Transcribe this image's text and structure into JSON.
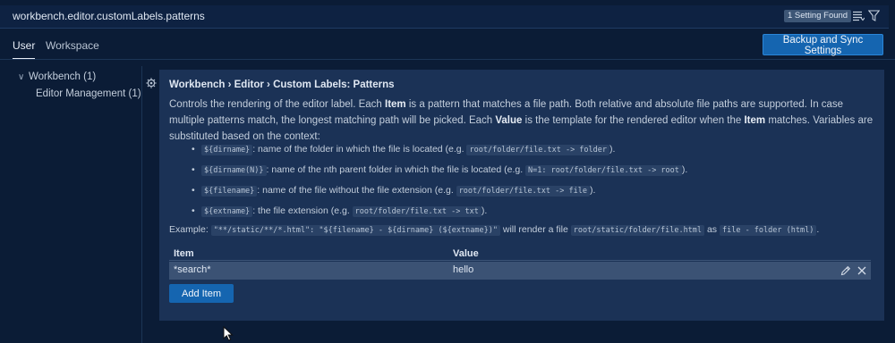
{
  "search": {
    "query": "workbench.editor.customLabels.patterns",
    "found_badge": "1 Setting Found"
  },
  "tabs": {
    "user": "User",
    "workspace": "Workspace"
  },
  "sync_button": "Backup and Sync Settings",
  "tree": {
    "workbench": "Workbench (1)",
    "editor_management": "Editor Management (1)"
  },
  "setting": {
    "title": "Workbench › Editor › Custom Labels: Patterns",
    "desc_1": "Controls the rendering of the editor label. Each ",
    "desc_item": "Item",
    "desc_2": " is a pattern that matches a file path. Both relative and absolute file paths are supported. In case multiple patterns match, the longest matching path will be picked. Each ",
    "desc_value": "Value",
    "desc_3": " is the template for the rendered editor when the ",
    "desc_item2": "Item",
    "desc_4": " matches. Variables are substituted based on the context:",
    "bullets": [
      {
        "code": "${dirname}",
        "text": ": name of the folder in which the file is located (e.g. ",
        "example": "root/folder/file.txt -> folder",
        "end": ")."
      },
      {
        "code": "${dirname(N)}",
        "text": ": name of the nth parent folder in which the file is located (e.g. ",
        "example": "N=1: root/folder/file.txt -> root",
        "end": ")."
      },
      {
        "code": "${filename}",
        "text": ": name of the file without the file extension (e.g. ",
        "example": "root/folder/file.txt -> file",
        "end": ")."
      },
      {
        "code": "${extname}",
        "text": ": the file extension (e.g. ",
        "example": "root/folder/file.txt -> txt",
        "end": ")."
      }
    ],
    "example": {
      "label": "Example: ",
      "code_1": "\"**/static/**/*.html\": \"${filename} - ${dirname} (${extname})\"",
      "mid": " will render a file ",
      "code_2": "root/static/folder/file.html",
      "as": " as ",
      "code_3": "file - folder (html)",
      "end": "."
    },
    "table": {
      "headers": {
        "item": "Item",
        "value": "Value"
      },
      "rows": [
        {
          "item": "*search*",
          "value": "hello"
        }
      ]
    },
    "add_button": "Add Item"
  },
  "colors": {
    "background": "#0b1c36",
    "panel": "#1b3256",
    "accent": "#1565b0",
    "row_highlight": "#3b5274"
  },
  "icons": [
    "list-icon",
    "filter-icon",
    "chevron-down-icon",
    "gear-icon",
    "edit-icon",
    "remove-icon",
    "mouse-cursor-icon"
  ]
}
